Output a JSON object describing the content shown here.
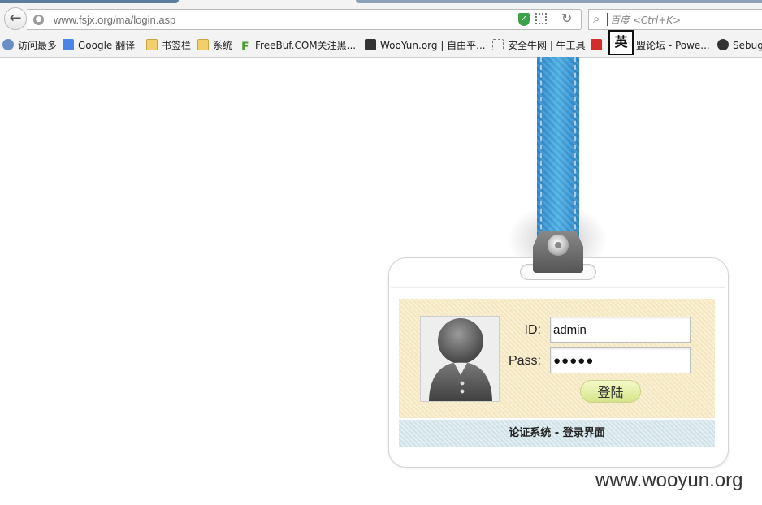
{
  "browser": {
    "url": "www.fsjx.org/ma/login.asp",
    "search_placeholder": "百度 <Ctrl+K>",
    "bookmarks": [
      {
        "label": "访问最多",
        "icon": "most-visited-icon"
      },
      {
        "label": "Google 翻译",
        "icon": "google-translate-icon"
      },
      {
        "label": "书签栏",
        "icon": "folder-icon"
      },
      {
        "label": "系统",
        "icon": "folder-icon"
      },
      {
        "label": "FreeBuf.COM关注黑...",
        "icon": "freebuf-icon"
      },
      {
        "label": "WooYun.org | 自由平...",
        "icon": "wooyun-icon"
      },
      {
        "label": "安全牛网 | 牛工具",
        "icon": "page-icon"
      },
      {
        "label": "盟论坛 - Powe...",
        "icon": "red-site-icon"
      },
      {
        "label": "Sebug",
        "icon": "sebug-icon"
      }
    ],
    "ime_indicator": "英"
  },
  "login": {
    "id_label": "ID:",
    "id_value": "admin",
    "pass_label": "Pass:",
    "pass_value": "●●●●●",
    "submit_label": "登陆",
    "footer_text": "论证系统 - 登录界面"
  },
  "watermark": "www.wooyun.org",
  "colors": {
    "strap": "#3a9ad8",
    "panel": "#f8ebc4",
    "footer": "#d4e6ec",
    "button": "#dbe79a"
  }
}
